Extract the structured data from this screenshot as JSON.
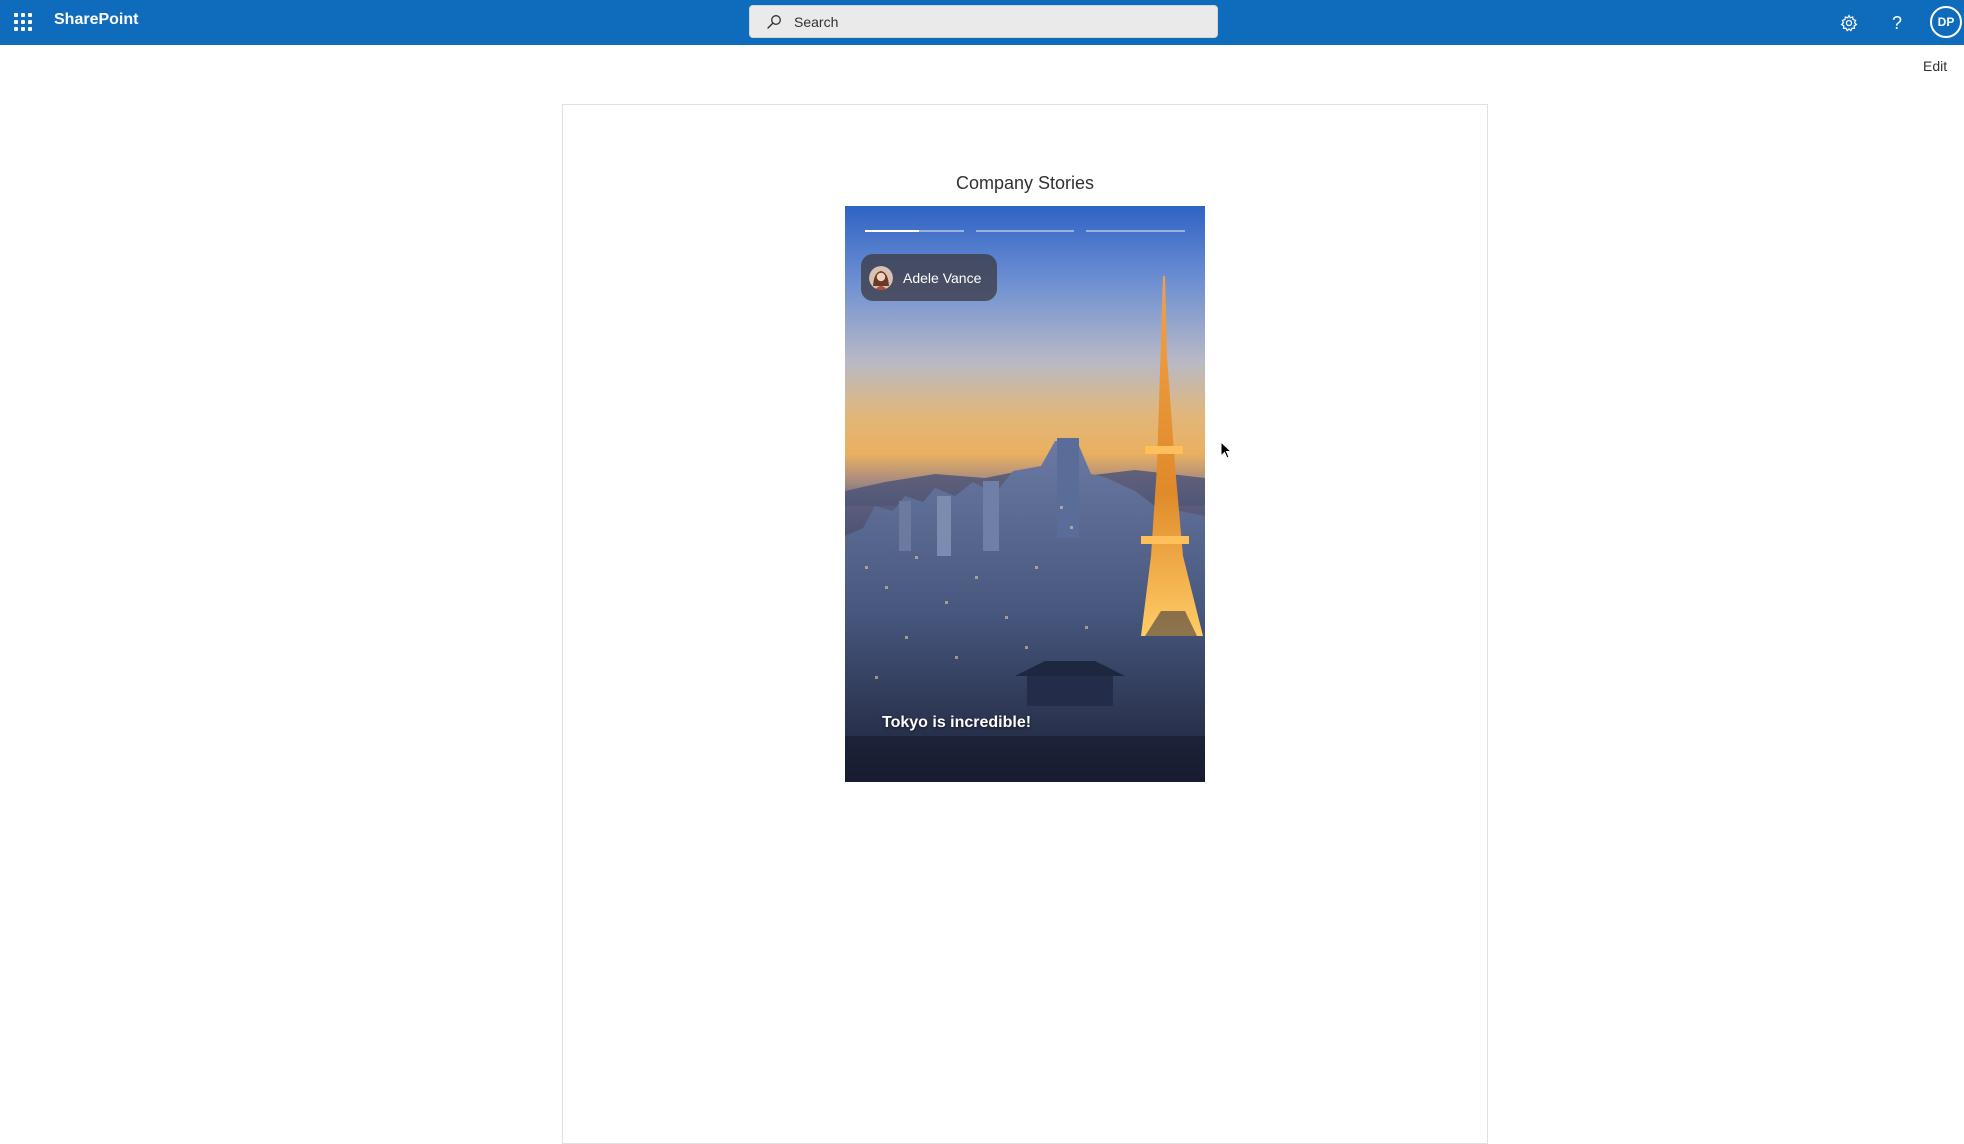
{
  "suite_bar": {
    "app_name": "SharePoint",
    "search_placeholder": "Search",
    "user_initials": "DP",
    "help_glyph": "?",
    "brand_color": "#0f6cbd",
    "icons": [
      "waffle-icon",
      "search-icon",
      "gear-icon",
      "help-icon"
    ]
  },
  "command_bar": {
    "edit_label": "Edit"
  },
  "section": {
    "title": "Company Stories"
  },
  "story": {
    "author": "Adele Vance",
    "caption": "Tokyo is incredible!",
    "progress": [
      0.55,
      0,
      0
    ]
  }
}
